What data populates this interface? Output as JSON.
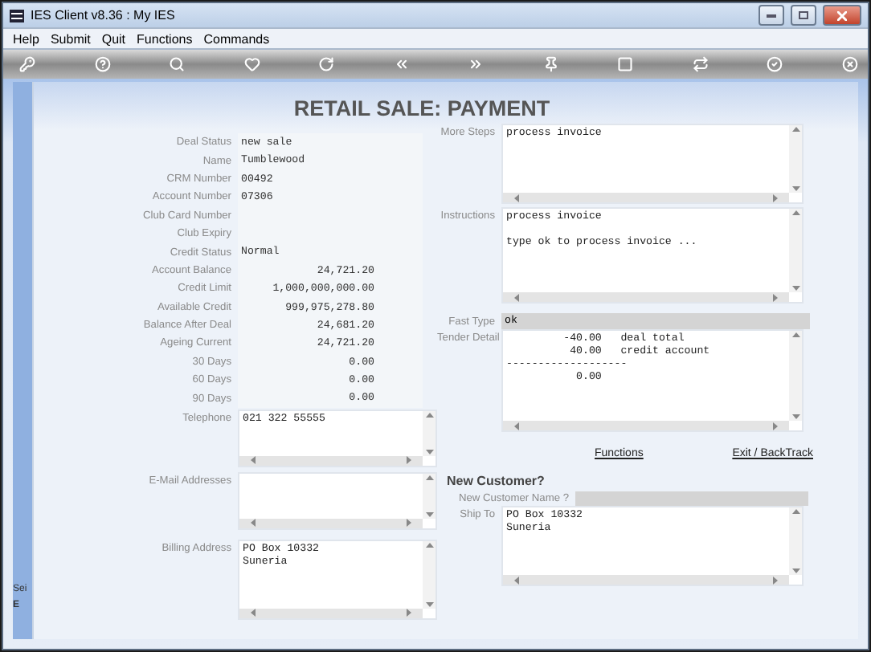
{
  "window": {
    "title": "IES Client v8.36 : My IES"
  },
  "menu": [
    "Help",
    "Submit",
    "Quit",
    "Functions",
    "Commands"
  ],
  "page_title": "RETAIL SALE: PAYMENT",
  "side_strip": [
    "Sei",
    "E"
  ],
  "customer_fields": [
    {
      "label": "Deal Status",
      "value": "new sale",
      "kind": "text"
    },
    {
      "label": "Name",
      "value": "Tumblewood",
      "kind": "text"
    },
    {
      "label": "CRM Number",
      "value": "00492",
      "kind": "text"
    },
    {
      "label": "Account Number",
      "value": "07306",
      "kind": "text"
    },
    {
      "label": "Club Card Number",
      "kind": "text"
    },
    {
      "label": "Club Expiry",
      "kind": "text"
    },
    {
      "label": "Credit Status",
      "value": "Normal",
      "kind": "text"
    },
    {
      "label": "Account Balance",
      "value": "24,721.20",
      "kind": "amount"
    },
    {
      "label": "Credit Limit",
      "value": "1,000,000,000.00",
      "kind": "amount"
    },
    {
      "label": "Available Credit",
      "value": "999,975,278.80",
      "kind": "amount"
    },
    {
      "label": "Balance After Deal",
      "value": "24,681.20",
      "kind": "amount"
    },
    {
      "label": "Ageing Current",
      "value": "24,721.20",
      "kind": "amount"
    },
    {
      "label": "30 Days",
      "value": "0.00",
      "kind": "amount"
    },
    {
      "label": "60 Days",
      "value": "0.00",
      "kind": "amount"
    },
    {
      "label": "90 Days",
      "value": "0.00",
      "kind": "amount"
    }
  ],
  "left_boxes": [
    {
      "label": "Telephone",
      "text": "021 322 55555"
    },
    {
      "label": "E-Mail Addresses"
    },
    {
      "label": "Billing Address",
      "text": "PO Box 10332\nSuneria"
    }
  ],
  "more_steps": {
    "label": "More Steps",
    "text": "process invoice"
  },
  "instructions": {
    "label": "Instructions",
    "text": "process invoice\n\ntype ok to process invoice ..."
  },
  "fast_type": {
    "label": "Fast Type",
    "value": "ok"
  },
  "tender_detail": {
    "label": "Tender Detail",
    "text": "         -40.00   deal total\n          40.00   credit account\n-------------------\n           0.00"
  },
  "links": [
    "Functions",
    "Exit / BackTrack"
  ],
  "new_customer": {
    "heading": "New Customer?",
    "name_label": "New Customer Name ?",
    "ship_to": {
      "label": "Ship To",
      "text": "PO Box 10332\nSuneria"
    }
  }
}
